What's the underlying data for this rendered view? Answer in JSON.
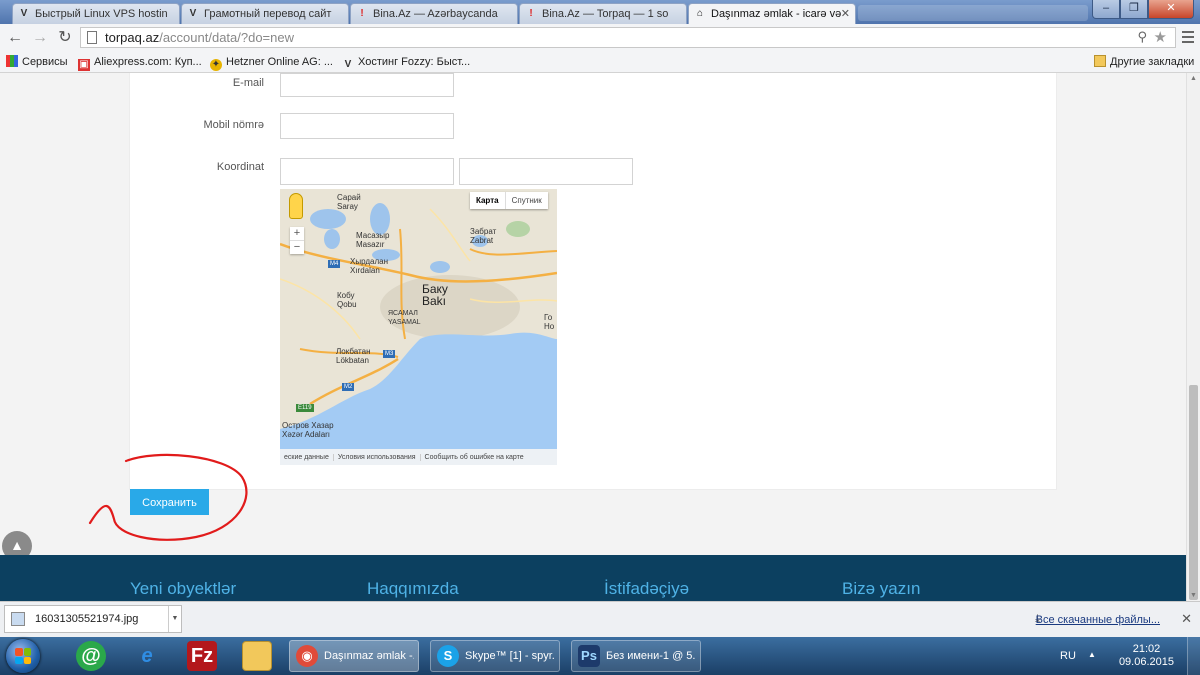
{
  "browser": {
    "tabs": [
      {
        "label": "Быстрый Linux VPS hostin",
        "icon": "V"
      },
      {
        "label": "Грамотный перевод сайт",
        "icon": "V"
      },
      {
        "label": "Bina.Az — Azərbaycanda",
        "icon": "!"
      },
      {
        "label": "Bina.Az — Torpaq — 1 so",
        "icon": "!"
      },
      {
        "label": "Daşınmaz əmlak - icarə və",
        "icon": "⌂"
      }
    ],
    "url_host": "torpaq.az",
    "url_path": "/account/data/?do=new",
    "bookmarks": [
      {
        "label": "Сервисы"
      },
      {
        "label": "Aliexpress.com: Куп..."
      },
      {
        "label": "Hetzner Online AG: ..."
      },
      {
        "label": "Хостинг Fozzy: Быст..."
      }
    ],
    "other_bookmarks": "Другие закладки"
  },
  "form": {
    "email_label": "E-mail",
    "mobile_label": "Mobil nömrə",
    "coord_label": "Koordinat",
    "save_label": "Сохранить"
  },
  "map": {
    "type_map": "Карта",
    "type_satellite": "Спутник",
    "labels": {
      "saray_ru": "Сарай",
      "saray": "Saray",
      "masazir_ru": "Масазыр",
      "masazir": "Masazır",
      "zabrat_ru": "Забрат",
      "zabrat": "Zabrat",
      "xirdalan_ru": "Хырдалан",
      "xirdalan": "Xırdalan",
      "qobu_ru": "Кобу",
      "qobu": "Qobu",
      "baku_ru": "Баку",
      "baku": "Bakı",
      "yasamal_ru": "ЯСАМАЛ",
      "yasamal": "YASAMAL",
      "lokbatan_ru": "Локбатан",
      "lokbatan": "Lökbatan",
      "xazar_ru": "Остров Хазар",
      "xazar": "Xəzər Adaları",
      "edge1": "Го",
      "edge2": "Но"
    },
    "roads": {
      "m4": "M4",
      "m3": "M3",
      "m2": "M2",
      "e119": "E119"
    },
    "footer": [
      "еские данные",
      "Условия использования",
      "Сообщить об ошибке на карте"
    ]
  },
  "footer_links": [
    "Yeni obyektlər",
    "Haqqımızda",
    "İstifadəçiyə",
    "Bizə yazın"
  ],
  "downloads": {
    "file": "16031305521974.jpg",
    "all": "Все скачанные файлы..."
  },
  "taskbar": {
    "tasks": [
      {
        "label": "Daşınmaz əmlak -...",
        "icon": "◉",
        "color": "#e04b3a"
      },
      {
        "label": "Skype™ [1] - spyr...",
        "icon": "S",
        "color": "#1ba2e8"
      },
      {
        "label": "Без имени-1 @ 5...",
        "icon": "Ps",
        "color": "#1d3a6b"
      }
    ],
    "lang": "RU",
    "time": "21:02",
    "date": "09.06.2015"
  },
  "colors": {
    "accent": "#29a9e8",
    "footer_bg": "#0c4060",
    "footer_link": "#4fb2e6",
    "annotation": "#e11b1b"
  }
}
